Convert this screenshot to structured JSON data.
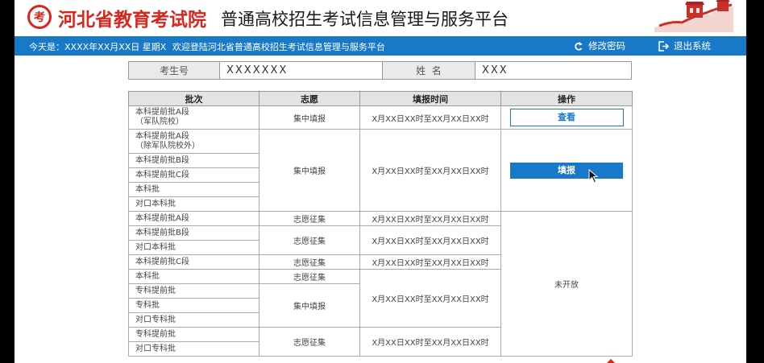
{
  "header": {
    "logo_glyph": "考",
    "logo_text": "河北省教育考试院",
    "platform_title": "普通高校招生考试信息管理与服务平台"
  },
  "bar": {
    "date_text": "今天是：XXXX年XX月XX日 星期X",
    "welcome_text": "欢迎登陆河北省普通高校招生考试信息管理与服务平台",
    "change_password": "修改密码",
    "logout": "退出系统",
    "color": "#1879c8"
  },
  "info": {
    "exam_no_label": "考生号",
    "exam_no_value": "XXXXXXX",
    "name_label": "姓  名",
    "name_value": "XXX"
  },
  "table": {
    "headers": [
      "批次",
      "志愿",
      "填报时间",
      "操作"
    ],
    "batches": [
      "本科提前批A段\n（军队院校）",
      "本科提前批A段\n（除军队院校外）",
      "本科提前批B段",
      "本科提前批C段",
      "本科批",
      "对口本科批",
      "本科提前批A段",
      "本科提前批B段",
      "对口本科批",
      "本科提前批C段",
      "本科批",
      "专科提前批",
      "专科批",
      "对口专科批",
      "专科提前批",
      "对口专科批"
    ],
    "volunteers": [
      "集中填报",
      "集中填报",
      "志愿征集",
      "志愿征集",
      "志愿征集",
      "志愿征集",
      "集中填报",
      "志愿征集"
    ],
    "times": [
      "X月XX日XX时至XX月XX日XX时",
      "X月XX日XX时至XX月XX日XX时",
      "X月XX日XX时至XX月XX日XX时",
      "X月XX日XX时至XX月XX日XX时",
      "X月XX日XX时至XX月XX日XX时",
      "X月XX日XX时至XX月XX日XX时",
      "X月XX日XX时至XX月XX日XX时"
    ],
    "view_button": "查看",
    "fill_button": "填报",
    "not_open": "未开放"
  }
}
